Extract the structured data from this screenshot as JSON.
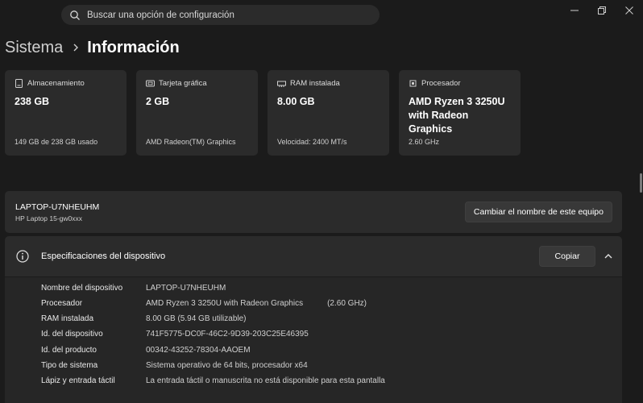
{
  "search": {
    "placeholder": "Buscar una opción de configuración"
  },
  "breadcrumb": {
    "parent": "Sistema",
    "current": "Información"
  },
  "cards": [
    {
      "icon": "storage-icon",
      "label": "Almacenamiento",
      "value": "238 GB",
      "sub": "149 GB de 238 GB usado"
    },
    {
      "icon": "gpu-icon",
      "label": "Tarjeta gráfica",
      "value": "2 GB",
      "sub": "AMD Radeon(TM) Graphics"
    },
    {
      "icon": "ram-icon",
      "label": "RAM instalada",
      "value": "8.00 GB",
      "sub": "Velocidad: 2400 MT/s"
    },
    {
      "icon": "cpu-icon",
      "label": "Procesador",
      "value": "AMD Ryzen 3 3250U with Radeon Graphics",
      "sub": "2.60 GHz"
    }
  ],
  "device": {
    "name": "LAPTOP-U7NHEUHM",
    "model": "HP Laptop 15-gw0xxx",
    "rename_label": "Cambiar el nombre de este equipo"
  },
  "specs": {
    "title": "Especificaciones del dispositivo",
    "copy_label": "Copiar",
    "rows": [
      {
        "label": "Nombre del dispositivo",
        "value": "LAPTOP-U7NHEUHM",
        "extra": ""
      },
      {
        "label": "Procesador",
        "value": "AMD Ryzen 3 3250U with Radeon Graphics",
        "extra": "(2.60 GHz)"
      },
      {
        "label": "RAM instalada",
        "value": "8.00 GB (5.94 GB utilizable)",
        "extra": ""
      },
      {
        "label": "Id. del dispositivo",
        "value": "741F5775-DC0F-46C2-9D39-203C25E46395",
        "extra": ""
      },
      {
        "label": "Id. del producto",
        "value": "00342-43252-78304-AAOEM",
        "extra": ""
      },
      {
        "label": "Tipo de sistema",
        "value": "Sistema operativo de 64 bits, procesador x64",
        "extra": ""
      },
      {
        "label": "Lápiz y entrada táctil",
        "value": "La entrada táctil o manuscrita no está disponible para esta pantalla",
        "extra": ""
      }
    ]
  }
}
